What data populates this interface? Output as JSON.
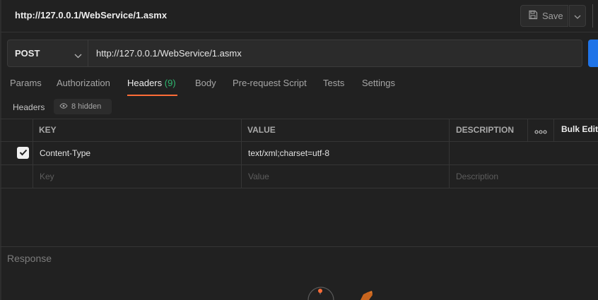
{
  "title": "http://127.0.0.1/WebService/1.asmx",
  "toolbar": {
    "save_label": "Save"
  },
  "request": {
    "method": "POST",
    "url": "http://127.0.0.1/WebService/1.asmx"
  },
  "tabs": [
    {
      "label": "Params"
    },
    {
      "label": "Authorization"
    },
    {
      "label": "Headers",
      "count": "(9)"
    },
    {
      "label": "Body"
    },
    {
      "label": "Pre-request Script"
    },
    {
      "label": "Tests"
    },
    {
      "label": "Settings"
    }
  ],
  "headers_section": {
    "label": "Headers",
    "hidden_text": "8 hidden"
  },
  "table": {
    "columns": {
      "key": "KEY",
      "value": "VALUE",
      "description": "DESCRIPTION"
    },
    "more_icon": "ellipsis-icon",
    "bulk_edit": "Bulk Edit",
    "rows": [
      {
        "checked": true,
        "key": "Content-Type",
        "value": "text/xml;charset=utf-8",
        "description": ""
      }
    ],
    "placeholders": {
      "key": "Key",
      "value": "Value",
      "description": "Description"
    }
  },
  "response": {
    "label": "Response"
  },
  "colors": {
    "accent": "#ff6c37",
    "count": "#2fb870",
    "send": "#1f74e8"
  }
}
